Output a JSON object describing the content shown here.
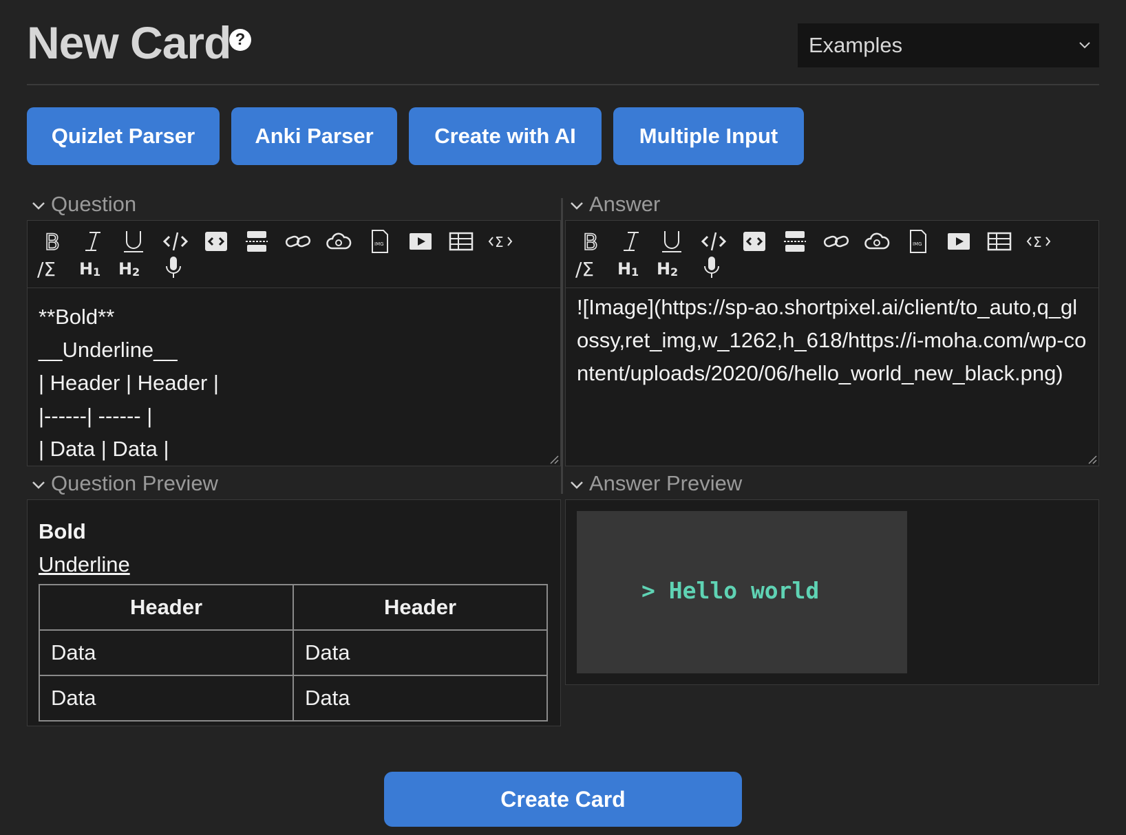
{
  "header": {
    "title": "New Card",
    "help_icon": "?",
    "examples_select": {
      "selected": "Examples",
      "icon": "chevron-down-icon"
    }
  },
  "buttons": [
    {
      "label": "Quizlet Parser"
    },
    {
      "label": "Anki Parser"
    },
    {
      "label": "Create with AI"
    },
    {
      "label": "Multiple Input"
    }
  ],
  "question": {
    "label": "Question",
    "toolbar_icons": [
      "bold-icon",
      "italic-icon",
      "underline-icon",
      "code-inline-icon",
      "code-block-icon",
      "divider-icon",
      "link-icon",
      "cloud-upload-icon",
      "image-file-icon",
      "video-icon",
      "table-icon",
      "math-block-icon",
      "math-inline-icon",
      "heading1-icon",
      "heading2-icon",
      "microphone-icon"
    ],
    "content": [
      "**Bold**",
      "__Underline__",
      "| Header | Header |",
      "|------| ------ |",
      "| Data | Data |"
    ]
  },
  "answer": {
    "label": "Answer",
    "content": [
      "![Image](https://sp-ao.shortpixel.ai/client/to_auto,q_glossy,ret_img,w_1262,h_618/https://i-moha.com/wp-content/uploads/2020/06/hello_world_new_black.png)"
    ]
  },
  "question_preview": {
    "label": "Question Preview",
    "bold": "Bold",
    "underline": "Underline",
    "table": {
      "headers": [
        "Header",
        "Header"
      ],
      "rows": [
        [
          "Data",
          "Data"
        ],
        [
          "Data",
          "Data"
        ]
      ]
    }
  },
  "answer_preview": {
    "label": "Answer Preview",
    "image_text": "> Hello world"
  },
  "create_button": "Create Card",
  "colors": {
    "accent": "#3a7bd5",
    "background": "#232323",
    "panel": "#1b1b1b",
    "terminal_text": "#5fd3b4"
  }
}
